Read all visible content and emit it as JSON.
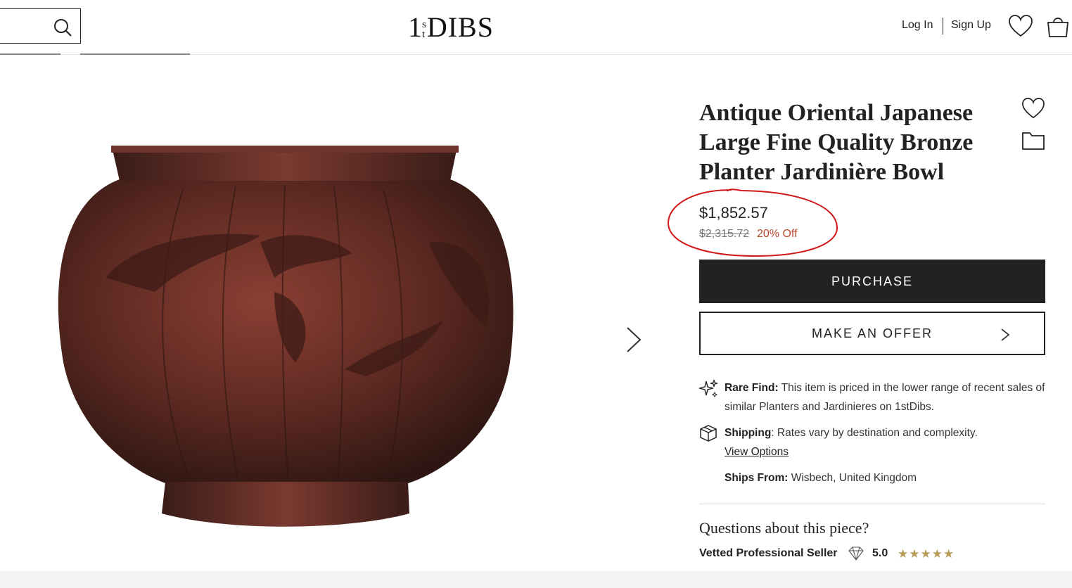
{
  "header": {
    "search_placeholder": "",
    "logo_one": "1",
    "logo_s": "s",
    "logo_t": "t",
    "logo_dibs": "DIBS",
    "login_label": "Log In",
    "signup_label": "Sign Up"
  },
  "product": {
    "title": "Antique Oriental Japanese Large Fine Quality Bronze Planter Jardinière Bowl",
    "price": "$1,852.57",
    "original_price": "$2,315.72",
    "discount": "20% Off",
    "purchase_label": "PURCHASE",
    "offer_label": "MAKE AN OFFER"
  },
  "info": {
    "rare_label": "Rare Find:",
    "rare_text": " This item is priced in the lower range of recent sales of similar Planters and Jardinieres on 1stDibs.",
    "shipping_label": "Shipping",
    "shipping_text": ": Rates vary by destination and complexity.",
    "view_options": "View Options",
    "ships_from_label": "Ships From:",
    "ships_from_value": " Wisbech, United Kingdom"
  },
  "seller": {
    "questions": "Questions about this piece?",
    "vetted_label": "Vetted Professional Seller",
    "rating": "5.0",
    "stars": "★★★★★"
  },
  "colors": {
    "accent_dark": "#222222",
    "discount_red": "#b5482b",
    "annotation_red": "#d01818",
    "star_gold": "#b89a55",
    "bronze": "#5e2a22"
  },
  "icons": [
    "search-icon",
    "heart-icon",
    "bag-icon",
    "chevron-right-icon",
    "folder-icon",
    "sparkle-icon",
    "box-icon",
    "diamond-icon"
  ]
}
